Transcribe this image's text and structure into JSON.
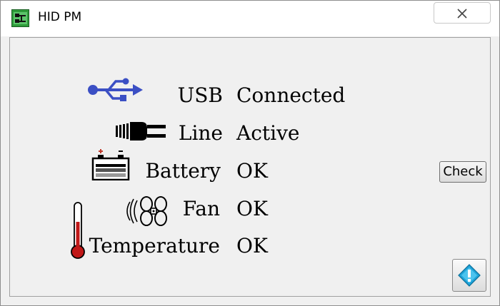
{
  "window": {
    "title": "HID PM",
    "icon": "hid-pm-app-icon",
    "close_icon": "close-icon"
  },
  "status": {
    "usb": {
      "label": "USB",
      "value": "Connected",
      "icon": "usb-icon"
    },
    "line": {
      "label": "Line",
      "value": "Active",
      "icon": "power-plug-icon"
    },
    "battery": {
      "label": "Battery",
      "value": "OK",
      "icon": "battery-icon"
    },
    "fan": {
      "label": "Fan",
      "value": "OK",
      "icon": "fan-icon"
    },
    "temperature": {
      "label": "Temperature",
      "value": "OK",
      "icon": "thermometer-icon"
    }
  },
  "buttons": {
    "check_label": "Check",
    "info_icon": "info-diamond-icon"
  },
  "colors": {
    "usb_blue": "#3b4fc4",
    "thermo_red": "#c01818",
    "info_blue": "#1fa3d9"
  }
}
